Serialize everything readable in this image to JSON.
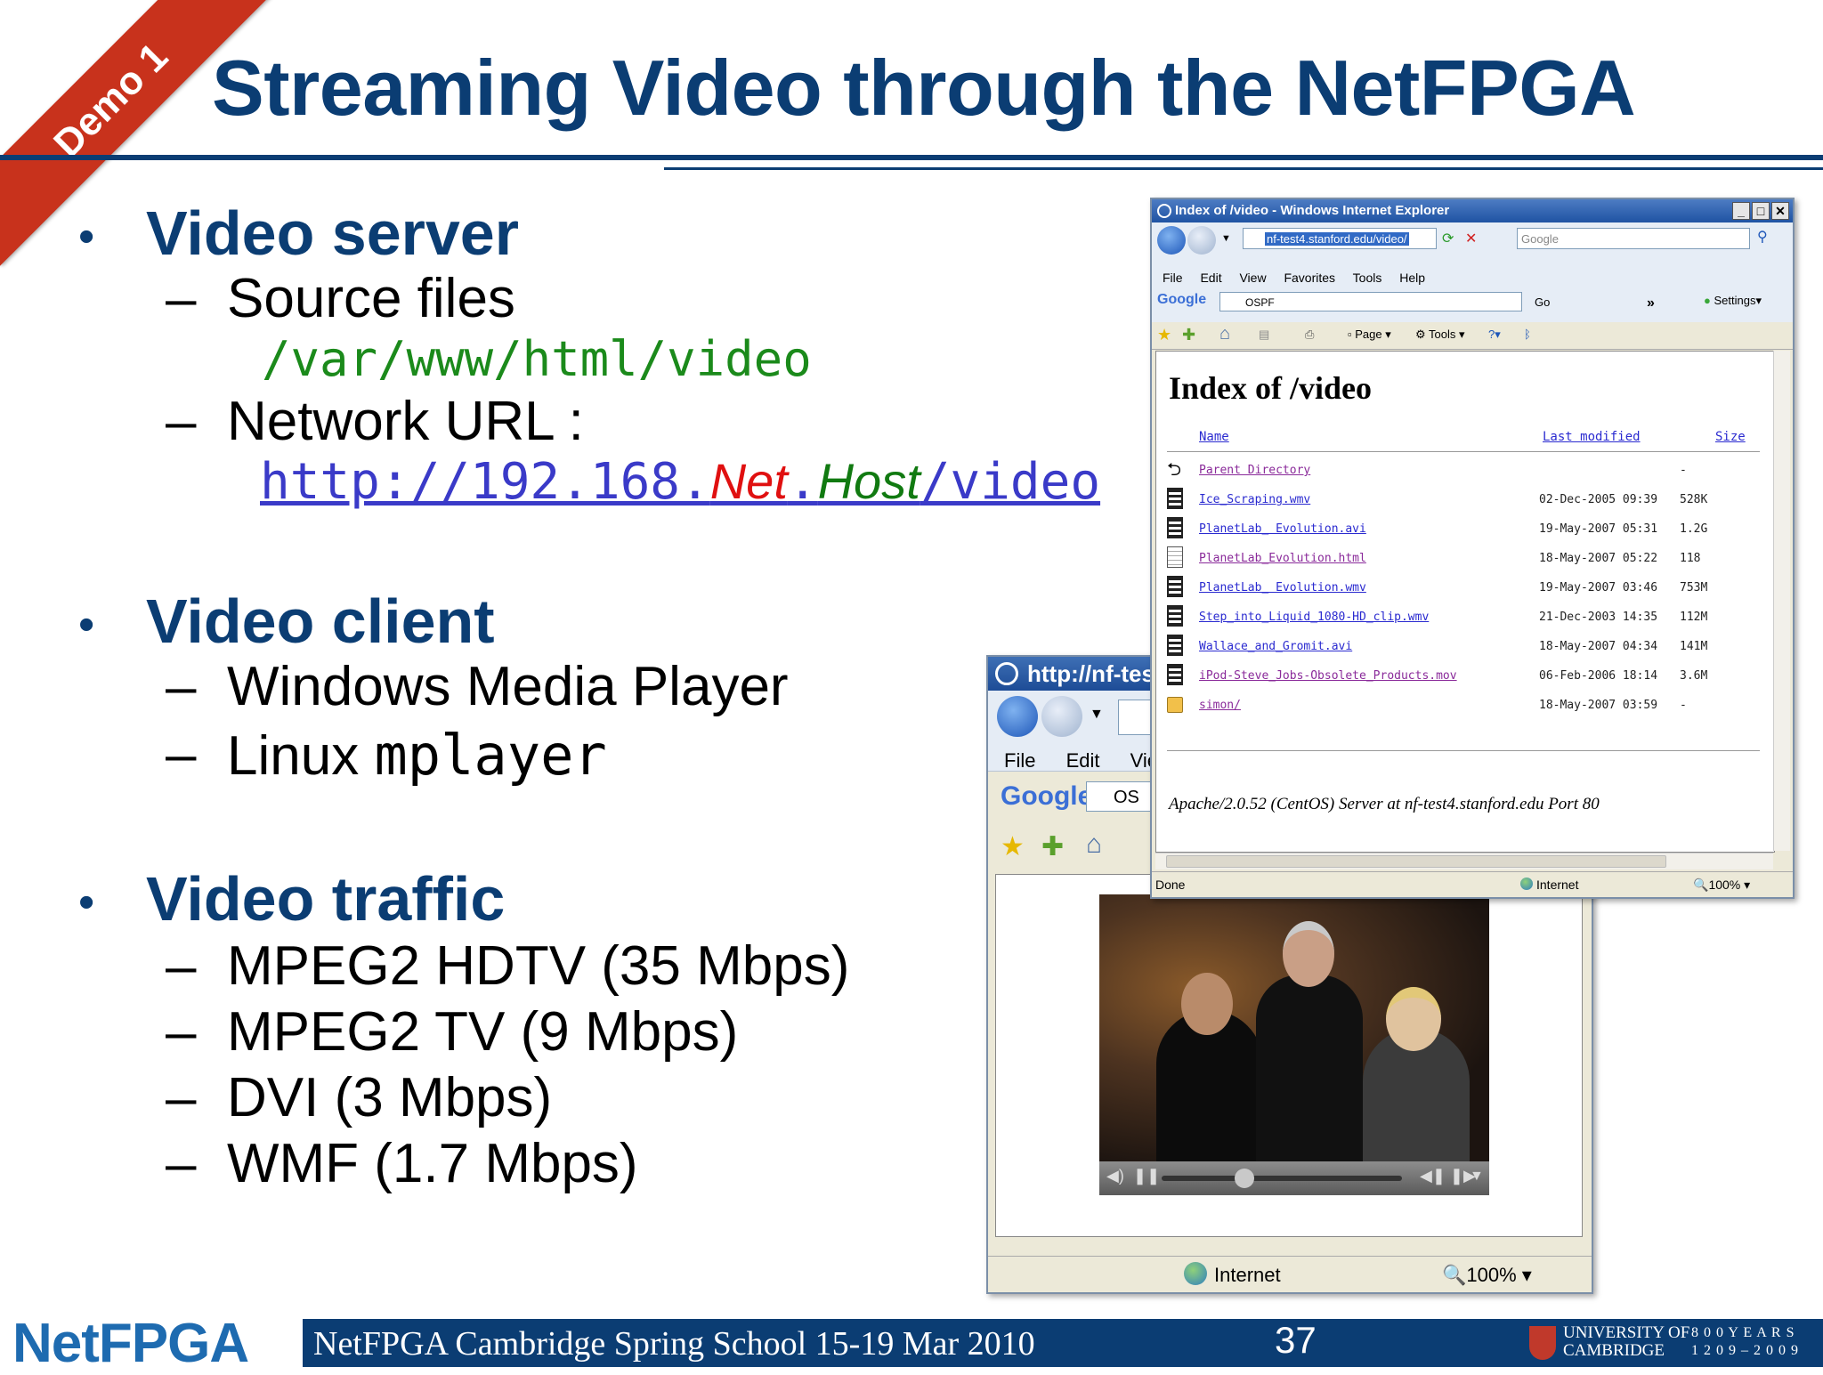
{
  "slide": {
    "badge": "Demo 1",
    "title": "Streaming Video through the NetFPGA",
    "bullets": {
      "server": {
        "label": "Video server",
        "source_label": "Source files",
        "source_path": "/var/www/html/video",
        "network_label": "Network URL :",
        "url_prefix": "http://192.168.",
        "url_net": "Net",
        "url_dot": ".",
        "url_host": "Host",
        "url_suffix": "/video"
      },
      "client": {
        "label": "Video client",
        "item1": "Windows Media Player",
        "item2_prefix": "Linux ",
        "item2_mono": "mplayer"
      },
      "traffic": {
        "label": "Video traffic",
        "items": [
          "MPEG2 HDTV (35 Mbps)",
          "MPEG2 TV (9 Mbps)",
          "DVI (3 Mbps)",
          "WMF (1.7 Mbps)"
        ]
      }
    },
    "dash": "–",
    "bullet": "•"
  },
  "browser_back": {
    "title": "http://nf-test",
    "menu": [
      "File",
      "Edit",
      "View"
    ],
    "google": "Google",
    "google_field": "OS",
    "status_zone": "Internet",
    "zoom": "100%"
  },
  "browser_front": {
    "title": "Index of /video - Windows Internet Explorer",
    "address": "nf-test4.stanford.edu/video/",
    "search_placeholder": "Google",
    "menu": [
      "File",
      "Edit",
      "View",
      "Favorites",
      "Tools",
      "Help"
    ],
    "google": "Google",
    "google_field": "OSPF",
    "go": "Go",
    "settings": "Settings",
    "page_label": "Page",
    "tools_label": "Tools",
    "heading": "Index of /video",
    "col_name": "Name",
    "col_modified": "Last modified",
    "col_size": "Size",
    "rows": [
      {
        "name": "Parent Directory",
        "date": "",
        "size": "-",
        "icon": "back-arrow-icon",
        "visited": true
      },
      {
        "name": "Ice_Scraping.wmv",
        "date": "02-Dec-2005 09:39",
        "size": "528K",
        "icon": "film-icon",
        "visited": false
      },
      {
        "name": "PlanetLab_ Evolution.avi",
        "date": "19-May-2007 05:31",
        "size": "1.2G",
        "icon": "film-icon",
        "visited": false
      },
      {
        "name": "PlanetLab_Evolution.html",
        "date": "18-May-2007 05:22",
        "size": "118",
        "icon": "document-icon",
        "visited": true
      },
      {
        "name": "PlanetLab_ Evolution.wmv",
        "date": "19-May-2007 03:46",
        "size": "753M",
        "icon": "film-icon",
        "visited": false
      },
      {
        "name": "Step_into_Liquid_1080-HD_clip.wmv",
        "date": "21-Dec-2003 14:35",
        "size": "112M",
        "icon": "film-icon",
        "visited": false
      },
      {
        "name": "Wallace_and_Gromit.avi",
        "date": "18-May-2007 04:34",
        "size": "141M",
        "icon": "film-icon",
        "visited": false
      },
      {
        "name": "iPod-Steve_Jobs-Obsolete_Products.mov",
        "date": "06-Feb-2006 18:14",
        "size": "3.6M",
        "icon": "film-icon",
        "visited": true
      },
      {
        "name": "simon/",
        "date": "18-May-2007 03:59",
        "size": "-",
        "icon": "folder-icon",
        "visited": true
      }
    ],
    "signature": "Apache/2.0.52 (CentOS) Server at nf-test4.stanford.edu Port 80",
    "status_left": "Done",
    "status_zone": "Internet",
    "zoom": "100%"
  },
  "footer": {
    "logo": "NetFPGA",
    "event": "NetFPGA Cambridge Spring School 15-19 Mar 2010",
    "page_number": "37",
    "university_line1": "UNIVERSITY OF",
    "university_line2": "CAMBRIDGE",
    "anniversary_line1": "8 0 0  Y E A R S",
    "anniversary_line2": "1 2 0 9 – 2 0 0 9"
  },
  "colors": {
    "navy": "#0b3d73",
    "ribbon": "#c8321c",
    "path_green": "#1b8a1b",
    "url_blue": "#3a3ac8",
    "url_net_red": "#e01010",
    "url_host_green": "#117a11"
  }
}
